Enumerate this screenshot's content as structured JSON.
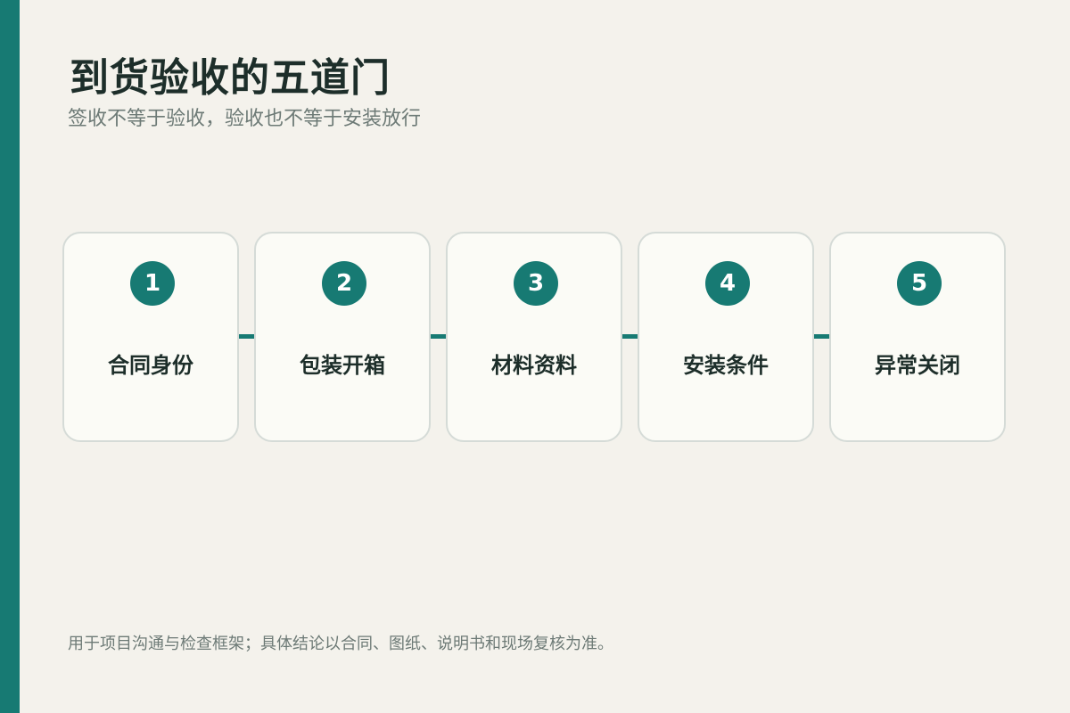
{
  "title": "到货验收的五道门",
  "subtitle": "签收不等于验收，验收也不等于安装放行",
  "steps": [
    {
      "number": "1",
      "label": "合同身份"
    },
    {
      "number": "2",
      "label": "包装开箱"
    },
    {
      "number": "3",
      "label": "材料资料"
    },
    {
      "number": "4",
      "label": "安装条件"
    },
    {
      "number": "5",
      "label": "异常关闭"
    }
  ],
  "footnote": "用于项目沟通与检查框架；具体结论以合同、图纸、说明书和现场复核为准。",
  "colors": {
    "accent": "#177a73",
    "background": "#f4f2ec",
    "card": "#fbfbf6",
    "title": "#1d2e2a",
    "muted": "#6d7a76"
  }
}
